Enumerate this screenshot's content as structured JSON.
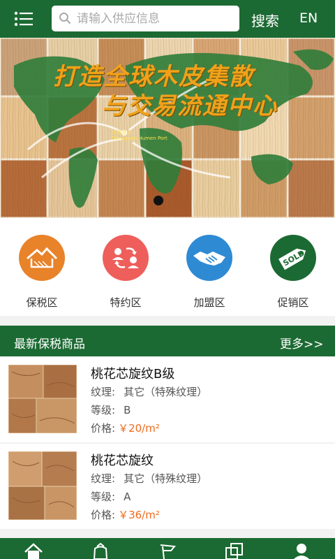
{
  "header": {
    "search_placeholder": "请输入供应信息",
    "search_button": "搜索",
    "lang_button": "EN"
  },
  "banner": {
    "title_line1": "打造全球木皮集散",
    "title_line2": "与交易流通中心",
    "port_label_cn": "东莞港口",
    "port_label_en": "Dongguan Humen Port"
  },
  "categories": [
    {
      "label": "保税区",
      "icon": "houses-icon",
      "color": "#e8832a"
    },
    {
      "label": "特约区",
      "icon": "user-exchange-icon",
      "color": "#ee5f5b"
    },
    {
      "label": "加盟区",
      "icon": "handshake-icon",
      "color": "#2f8ad4"
    },
    {
      "label": "促销区",
      "icon": "sold-tag-icon",
      "color": "#1c6a33"
    }
  ],
  "section": {
    "title": "最新保税商品",
    "more": "更多>>"
  },
  "products": [
    {
      "name": "桃花芯旋纹B级",
      "texture_label": "纹理:",
      "texture": "其它（特殊纹理）",
      "grade_label": "等级:",
      "grade": "B",
      "price_label": "价格:",
      "price": "￥20/m²"
    },
    {
      "name": "桃花芯旋纹",
      "texture_label": "纹理:",
      "texture": "其它（特殊纹理）",
      "grade_label": "等级:",
      "grade": "A",
      "price_label": "价格:",
      "price": "￥36/m²"
    }
  ],
  "tabbar": [
    {
      "icon": "home-icon"
    },
    {
      "icon": "bag-icon"
    },
    {
      "icon": "flag-icon"
    },
    {
      "icon": "layers-icon"
    },
    {
      "icon": "user-icon"
    }
  ],
  "colors": {
    "brand_green": "#1c6a33",
    "price_orange": "#f06a1a"
  }
}
